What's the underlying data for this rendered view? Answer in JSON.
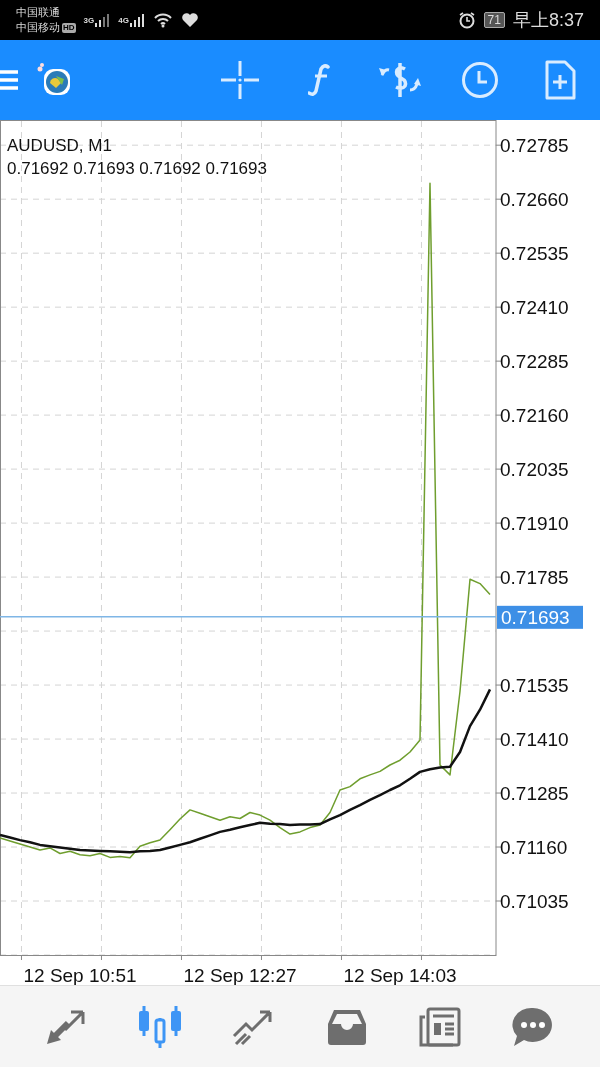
{
  "status_bar": {
    "carrier_1": "中国联通",
    "carrier_2": "中国移动",
    "hd_badge": "HD",
    "network_1": "3G",
    "network_2": "4G",
    "battery": "71",
    "time": "早上8:37"
  },
  "chart": {
    "quote": "0.71692 0.71693 0.71692 0.71693",
    "chart_data": {
      "type": "line",
      "title": "AUDUSD, M1",
      "categories": [
        null,
        null,
        null,
        null,
        null,
        null,
        null,
        null,
        "12 Sep 10:51",
        null,
        null,
        null,
        null,
        null,
        null,
        null,
        null,
        null,
        null,
        null,
        null,
        null,
        null,
        null,
        "12 Sep 12:27",
        null,
        null,
        null,
        null,
        null,
        null,
        null,
        null,
        null,
        null,
        null,
        null,
        null,
        null,
        null,
        "12 Sep 14:03",
        null,
        null,
        null,
        null,
        null,
        null,
        null,
        null,
        null
      ],
      "grid": true,
      "series": [
        {
          "color": "#6f9e2e",
          "values": [
            0.71181,
            0.71174,
            0.71167,
            0.7116,
            0.71153,
            0.71158,
            0.71145,
            0.7115,
            0.71142,
            0.7114,
            0.71145,
            0.71136,
            0.71138,
            0.71135,
            0.71162,
            0.7117,
            0.71176,
            0.712,
            0.71225,
            0.71246,
            0.71238,
            0.7123,
            0.71222,
            0.7123,
            0.71226,
            0.7124,
            0.71234,
            0.71222,
            0.71205,
            0.7119,
            0.71195,
            0.71205,
            0.71211,
            0.7124,
            0.71292,
            0.713,
            0.71318,
            0.71327,
            0.71335,
            0.7135,
            0.71361,
            0.7138,
            0.71408,
            0.72697,
            0.7135,
            0.71327,
            0.7152,
            0.7178,
            0.7177,
            0.71745
          ]
        },
        {
          "color": "#111111",
          "values": [
            0.71188,
            0.71182,
            0.71176,
            0.71171,
            0.71165,
            0.71162,
            0.71159,
            0.71156,
            0.71153,
            0.71152,
            0.71151,
            0.7115,
            0.71149,
            0.71148,
            0.7115,
            0.71151,
            0.71153,
            0.71159,
            0.71165,
            0.71171,
            0.71179,
            0.71187,
            0.71195,
            0.712,
            0.71206,
            0.71211,
            0.71216,
            0.71214,
            0.71213,
            0.71211,
            0.71212,
            0.71212,
            0.71213,
            0.71224,
            0.71234,
            0.71246,
            0.71257,
            0.71269,
            0.7128,
            0.71292,
            0.71303,
            0.71318,
            0.71334,
            0.7134,
            0.71344,
            0.71346,
            0.7138,
            0.7144,
            0.71478,
            0.71525
          ]
        }
      ],
      "ylim": [
        0.7091,
        0.72841
      ],
      "yticks": [
        0.72785,
        {
          "value": 0.7266,
          "label": "0.72660"
        },
        0.72535,
        {
          "value": 0.7241,
          "label": "0.72410"
        },
        0.72285,
        {
          "value": 0.7216,
          "label": "0.72160"
        },
        0.72035,
        {
          "value": 0.7191,
          "label": "0.71910"
        },
        0.71785,
        0.71535,
        {
          "value": 0.7141,
          "label": "0.71410"
        },
        0.71285,
        {
          "value": 0.7116,
          "label": "0.71160"
        },
        0.71035
      ],
      "ref_lines": [
        {
          "axis": "y",
          "value": 0.71693,
          "label": "0.71693"
        }
      ]
    }
  },
  "bottom_nav": [
    {
      "kind": "trade",
      "selected": false
    },
    {
      "kind": "chart",
      "selected": true
    },
    {
      "kind": "history",
      "selected": false
    },
    {
      "kind": "inbox",
      "selected": false
    },
    {
      "kind": "news",
      "selected": false
    },
    {
      "kind": "chat",
      "selected": false
    }
  ]
}
